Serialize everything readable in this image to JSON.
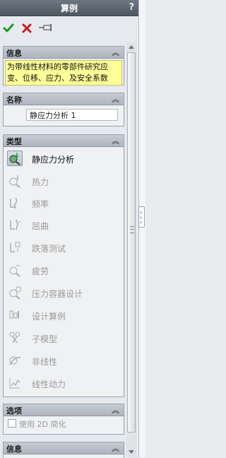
{
  "window": {
    "title": "算例",
    "help_label": "?"
  },
  "actions": [
    {
      "name": "ok",
      "icon": "checkmark-icon",
      "color": "#1a9a1a"
    },
    {
      "name": "cancel",
      "icon": "close-icon",
      "color": "#cc1a1a"
    },
    {
      "name": "pin",
      "icon": "pushpin-icon"
    }
  ],
  "info": {
    "header": "信息",
    "text_line1": "为带线性材料的零部件研究应",
    "text_line2": "变、位移、应力、及安全系数"
  },
  "name_section": {
    "header": "名称",
    "value": "静应力分析 1"
  },
  "type_section": {
    "header": "类型",
    "items": [
      {
        "label": "静应力分析",
        "icon": "static-analysis-icon",
        "active": true
      },
      {
        "label": "热力",
        "icon": "thermal-icon",
        "active": false
      },
      {
        "label": "频率",
        "icon": "frequency-icon",
        "active": false
      },
      {
        "label": "屈曲",
        "icon": "buckling-icon",
        "active": false
      },
      {
        "label": "跌落测试",
        "icon": "drop-test-icon",
        "active": false
      },
      {
        "label": "疲劳",
        "icon": "fatigue-icon",
        "active": false
      },
      {
        "label": "压力容器设计",
        "icon": "pressure-vessel-icon",
        "active": false
      },
      {
        "label": "设计算例",
        "icon": "design-study-icon",
        "active": false
      },
      {
        "label": "子模型",
        "icon": "submodel-icon",
        "active": false
      },
      {
        "label": "非线性",
        "icon": "nonlinear-icon",
        "active": false
      },
      {
        "label": "线性动力",
        "icon": "linear-dynamic-icon",
        "active": false
      }
    ]
  },
  "options_section": {
    "header": "选项",
    "use_2d_label": "使用 2D 简化",
    "use_2d_checked": false
  },
  "info_section_2": {
    "header": "信息"
  },
  "collapse_glyph": "︽",
  "accent": {
    "ok": "#1a9a1a",
    "cancel": "#cc1a1a",
    "info_bg": "#ffff99"
  }
}
